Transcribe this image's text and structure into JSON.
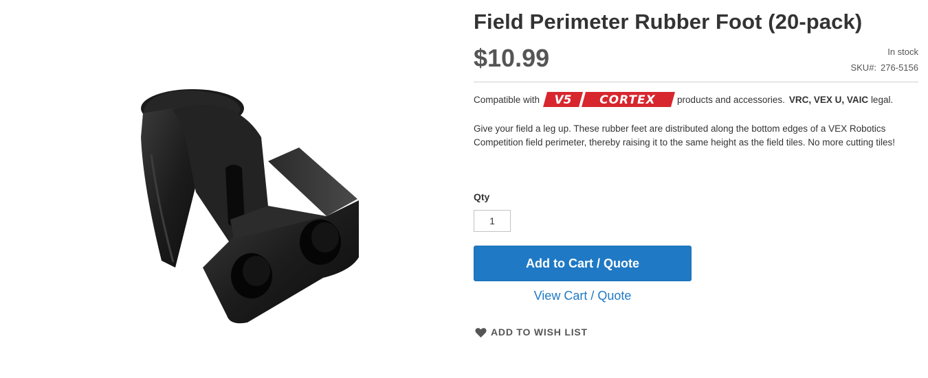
{
  "product": {
    "title": "Field Perimeter Rubber Foot (20-pack)",
    "price": "$10.99",
    "stock_status": "In stock",
    "sku_label": "SKU#:",
    "sku_value": "276-5156"
  },
  "compatibility": {
    "prefix": "Compatible with",
    "logo_text_1": "V5",
    "logo_text_2": "CORTEX",
    "suffix": "products and accessories.",
    "legal_bold": "VRC, VEX U, VAIC",
    "legal_suffix": "legal."
  },
  "description": "Give your field a leg up. These rubber feet are distributed along the bottom edges of a VEX Robotics Competition field perimeter, thereby raising it to the same height as the field tiles. No more cutting tiles!",
  "purchase": {
    "qty_label": "Qty",
    "qty_value": "1",
    "add_to_cart_label": "Add to Cart / Quote",
    "view_cart_label": "View Cart / Quote",
    "wishlist_label": "ADD TO WISH LIST"
  },
  "icons": {
    "wishlist": "heart-icon",
    "product_image": "rubber-foot-image"
  },
  "colors": {
    "accent_blue": "#1f79c4",
    "logo_red": "#d7262e",
    "text_dark": "#333333",
    "text_gray": "#555555"
  }
}
